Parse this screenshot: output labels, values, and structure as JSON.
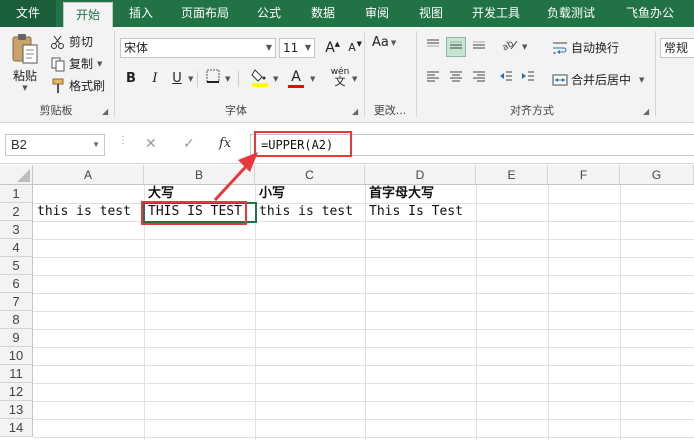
{
  "tabs": [
    "文件",
    "开始",
    "插入",
    "页面布局",
    "公式",
    "数据",
    "审阅",
    "视图",
    "开发工具",
    "负载测试",
    "飞鱼办公"
  ],
  "clipboard": {
    "paste": "粘贴",
    "cut": "剪切",
    "copy": "复制",
    "format_painter": "格式刷",
    "group": "剪贴板"
  },
  "font": {
    "name": "宋体",
    "size": "11",
    "bold": "B",
    "italic": "I",
    "underline": "U",
    "grow": "A",
    "shrink": "A",
    "font_color": "A",
    "phonetic": "wén",
    "group": "字体"
  },
  "change": {
    "label": "Aa",
    "group": "更改..."
  },
  "alignment": {
    "wrap": "自动换行",
    "merge": "合并后居中",
    "group": "对齐方式"
  },
  "number": {
    "format": "常规"
  },
  "formula_bar": {
    "name_box": "B2",
    "cancel": "✕",
    "enter": "✓",
    "fx": "fx",
    "formula": "=UPPER(A2)"
  },
  "columns": [
    "A",
    "B",
    "C",
    "D",
    "E",
    "F",
    "G"
  ],
  "rows": [
    "1",
    "2",
    "3",
    "4",
    "5",
    "6",
    "7",
    "8",
    "9",
    "10",
    "11",
    "12",
    "13",
    "14"
  ],
  "cells": {
    "B1": "大写",
    "C1": "小写",
    "D1": "首字母大写",
    "A2": "this is test",
    "B2": "THIS IS TEST",
    "C2": "this is test",
    "D2": "This Is Test"
  },
  "colors": {
    "brand": "#217346",
    "annotation": "#e8383d",
    "fill_highlight": "#ffff00",
    "font_red": "#ff0000"
  }
}
